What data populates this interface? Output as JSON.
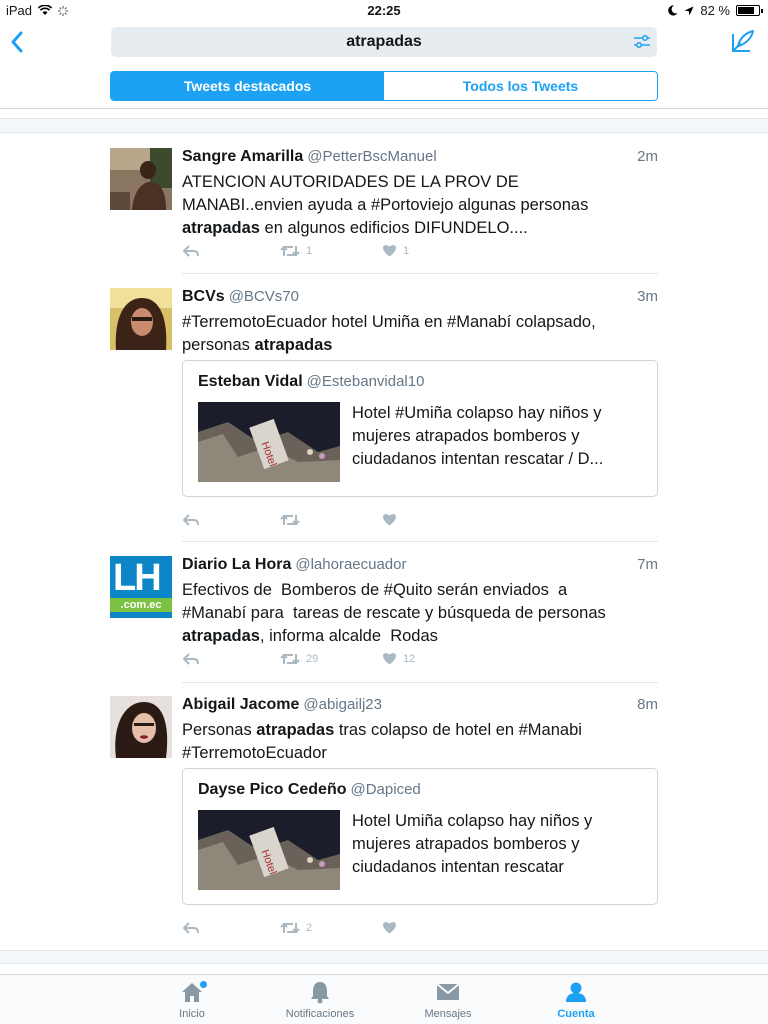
{
  "status_bar": {
    "device": "iPad",
    "time": "22:25",
    "battery_text": "82 %",
    "battery_level": 0.82
  },
  "nav": {
    "search_query": "atrapadas",
    "tabs": [
      {
        "label": "Tweets destacados",
        "active": true
      },
      {
        "label": "Todos los Tweets",
        "active": false
      }
    ]
  },
  "tweets": [
    {
      "name": "Sangre Amarilla",
      "handle": "@PetterBscManuel",
      "time": "2m",
      "text_lines": [
        [
          {
            "t": "ATENCION AUTORIDADES DE LA PROV DE"
          }
        ],
        [
          {
            "t": "MANABI..envien ayuda a #Portoviejo algunas personas"
          }
        ],
        [
          {
            "t": "atrapadas",
            "b": true
          },
          {
            "t": " en algunos edificios DIFUNDELO...."
          }
        ]
      ],
      "retweets": "1",
      "likes": "1"
    },
    {
      "name": "BCVs",
      "handle": "@BCVs70",
      "time": "3m",
      "text_lines": [
        [
          {
            "t": "#TerremotoEcuador hotel Umiña en #Manabí colapsado,"
          }
        ],
        [
          {
            "t": "personas "
          },
          {
            "t": "atrapadas",
            "b": true
          }
        ]
      ],
      "quote": {
        "name": "Esteban Vidal",
        "handle": "@Estebanvidal10",
        "text_lines": [
          "Hotel #Umiña colapso hay niños y",
          "mujeres atrapados bomberos y",
          "ciudadanos intentan rescatar / D..."
        ]
      },
      "retweets": "",
      "likes": ""
    },
    {
      "name": "Diario La Hora",
      "handle": "@lahoraecuador",
      "time": "7m",
      "avatar_text": {
        "big": "LH",
        "small": ".com.ec"
      },
      "text_lines": [
        [
          {
            "t": "Efectivos de  Bomberos de #Quito serán enviados  a"
          }
        ],
        [
          {
            "t": "#Manabí para  tareas de rescate y búsqueda de personas"
          }
        ],
        [
          {
            "t": "atrapadas",
            "b": true
          },
          {
            "t": ", informa alcalde  Rodas"
          }
        ]
      ],
      "retweets": "29",
      "likes": "12"
    },
    {
      "name": "Abigail Jacome",
      "handle": "@abigailj23",
      "time": "8m",
      "text_lines": [
        [
          {
            "t": "Personas "
          },
          {
            "t": "atrapadas",
            "b": true
          },
          {
            "t": " tras colapso de hotel en #Manabi"
          }
        ],
        [
          {
            "t": "#TerremotoEcuador"
          }
        ]
      ],
      "quote": {
        "name": "Dayse Pico Cedeño",
        "handle": "@Dapiced",
        "text_lines": [
          "Hotel Umiña colapso hay niños y",
          "mujeres atrapados bomberos y",
          "ciudadanos intentan rescatar"
        ]
      },
      "retweets": "2",
      "likes": ""
    }
  ],
  "tab_bar": [
    {
      "label": "Inicio",
      "icon": "home-icon",
      "active": false,
      "badge": true
    },
    {
      "label": "Notificaciones",
      "icon": "bell-icon",
      "active": false
    },
    {
      "label": "Mensajes",
      "icon": "envelope-icon",
      "active": false
    },
    {
      "label": "Cuenta",
      "icon": "person-icon",
      "active": true
    }
  ],
  "colors": {
    "accent": "#1da1f2",
    "muted": "#657786",
    "icon_gray": "#aab8c2"
  }
}
